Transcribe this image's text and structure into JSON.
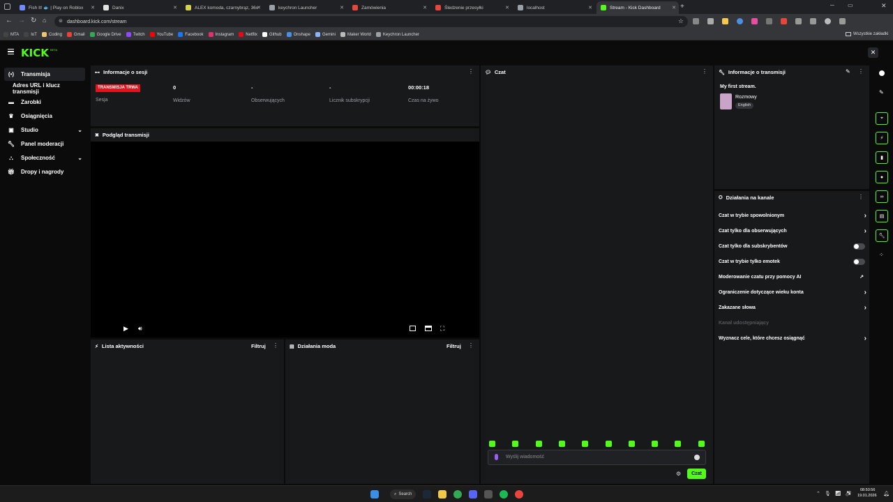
{
  "browser": {
    "tabs": [
      {
        "label": "Fish It! 🐟 | Play on Roblox",
        "color": "#6e8bff"
      },
      {
        "label": "Danix",
        "color": "#e2e2e2"
      },
      {
        "label": "ALEX komoda, czarnybrąz, 36x",
        "color": "#d6d14a"
      },
      {
        "label": "keychron Launcher",
        "color": "#9aa0a6"
      },
      {
        "label": "Zamówienia",
        "color": "#e8453c"
      },
      {
        "label": "Śledzenie przesyłki",
        "color": "#e8453c"
      },
      {
        "label": "localhost",
        "color": "#9aa0a6"
      },
      {
        "label": "Stream - Kick Dashboard",
        "color": "#53fc18"
      }
    ],
    "new_tab": "+",
    "url": "dashboard.kick.com/stream",
    "bookmarks": [
      {
        "label": "MTA",
        "color": "#444"
      },
      {
        "label": "IoT",
        "color": "#444"
      },
      {
        "label": "Coding",
        "color": "#f0c36d"
      },
      {
        "label": "Gmail",
        "color": "#ea4335"
      },
      {
        "label": "Google Drive",
        "color": "#34a853"
      },
      {
        "label": "Twitch",
        "color": "#9146ff"
      },
      {
        "label": "YouTube",
        "color": "#ff0000"
      },
      {
        "label": "Facebook",
        "color": "#1877f2"
      },
      {
        "label": "Instagram",
        "color": "#e1306c"
      },
      {
        "label": "Netflix",
        "color": "#e50914"
      },
      {
        "label": "Github",
        "color": "#ffffff"
      },
      {
        "label": "Onshape",
        "color": "#4a90e2"
      },
      {
        "label": "Gemini",
        "color": "#8ab4f8"
      },
      {
        "label": "Maker World",
        "color": "#bbbbbb"
      },
      {
        "label": "Keychron Launcher",
        "color": "#9aa0a6"
      }
    ],
    "other_bookmarks": "Wszystkie zakładki"
  },
  "kick": {
    "logo": "KICK",
    "logo_badge": "BETA",
    "accent": "#53fc18"
  },
  "sidebar": {
    "items": [
      {
        "label": "Transmisja",
        "icon": "broadcast-icon"
      },
      {
        "label": "Adres URL i klucz transmisji",
        "icon": ""
      },
      {
        "label": "Zarobki",
        "icon": "wallet-icon"
      },
      {
        "label": "Osiągnięcia",
        "icon": "trophy-icon"
      },
      {
        "label": "Studio",
        "icon": "studio-icon"
      },
      {
        "label": "Panel moderacji",
        "icon": "wrench-icon"
      },
      {
        "label": "Społeczność",
        "icon": "community-icon"
      },
      {
        "label": "Dropy i nagrody",
        "icon": "gift-icon"
      }
    ]
  },
  "session": {
    "title": "Informacje o sesji",
    "live_badge": "TRANSMISJA TRWA",
    "live_label": "Sesja",
    "stats": [
      {
        "value": "0",
        "label": "Widzów"
      },
      {
        "value": "-",
        "label": "Obserwujących"
      },
      {
        "value": "-",
        "label": "Licznik subskrypcji"
      },
      {
        "value": "00:00:18",
        "label": "Czas na żywo"
      }
    ]
  },
  "preview": {
    "title": "Podgląd transmisji"
  },
  "activity": {
    "title": "Lista aktywności",
    "filter": "Filtruj"
  },
  "mod_actions": {
    "title": "Działania moda",
    "filter": "Filtruj"
  },
  "chat": {
    "title": "Czat",
    "placeholder": "Wyślij wiadomość",
    "send_label": "Czat",
    "emotes_count": 10
  },
  "stream_info": {
    "title": "Informacje o transmisji",
    "stream_title": "My first stream.",
    "category": "Rozmowy",
    "language": "English"
  },
  "channel_actions": {
    "title": "Działania na kanale",
    "items": [
      {
        "label": "Czat w trybie spowolnionym",
        "control": "arrow"
      },
      {
        "label": "Czat tylko dla obserwujących",
        "control": "arrow"
      },
      {
        "label": "Czat tylko dla subskrybentów",
        "control": "toggle"
      },
      {
        "label": "Czat w trybie tylko emotek",
        "control": "toggle"
      },
      {
        "label": "Moderowanie czatu przy pomocy AI",
        "control": "external"
      },
      {
        "label": "Ograniczenie dotyczące wieku konta",
        "control": "arrow"
      },
      {
        "label": "Zakazane słowa",
        "control": "arrow"
      },
      {
        "label": "Kanał udostępniający",
        "control": "disabled"
      },
      {
        "label": "Wyznacz cele, które chcesz osiągnąć",
        "control": "arrow"
      }
    ]
  },
  "taskbar": {
    "search": "Search",
    "time": "08:50:56",
    "date": "19.01.2026"
  }
}
